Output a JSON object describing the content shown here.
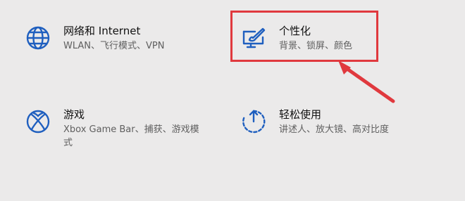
{
  "tiles": [
    {
      "title": "网络和 Internet",
      "description": "WLAN、飞行模式、VPN",
      "icon": "globe-icon"
    },
    {
      "title": "个性化",
      "description": "背景、锁屏、颜色",
      "icon": "personalization-pen-icon"
    },
    {
      "title": "游戏",
      "description": "Xbox Game Bar、捕获、游戏模式",
      "icon": "xbox-icon"
    },
    {
      "title": "轻松使用",
      "description": "讲述人、放大镜、高对比度",
      "icon": "ease-of-access-timer-icon"
    }
  ],
  "colors": {
    "accent": "#1f5fbf",
    "highlight": "#e0393e",
    "background": "#ebeaea"
  }
}
